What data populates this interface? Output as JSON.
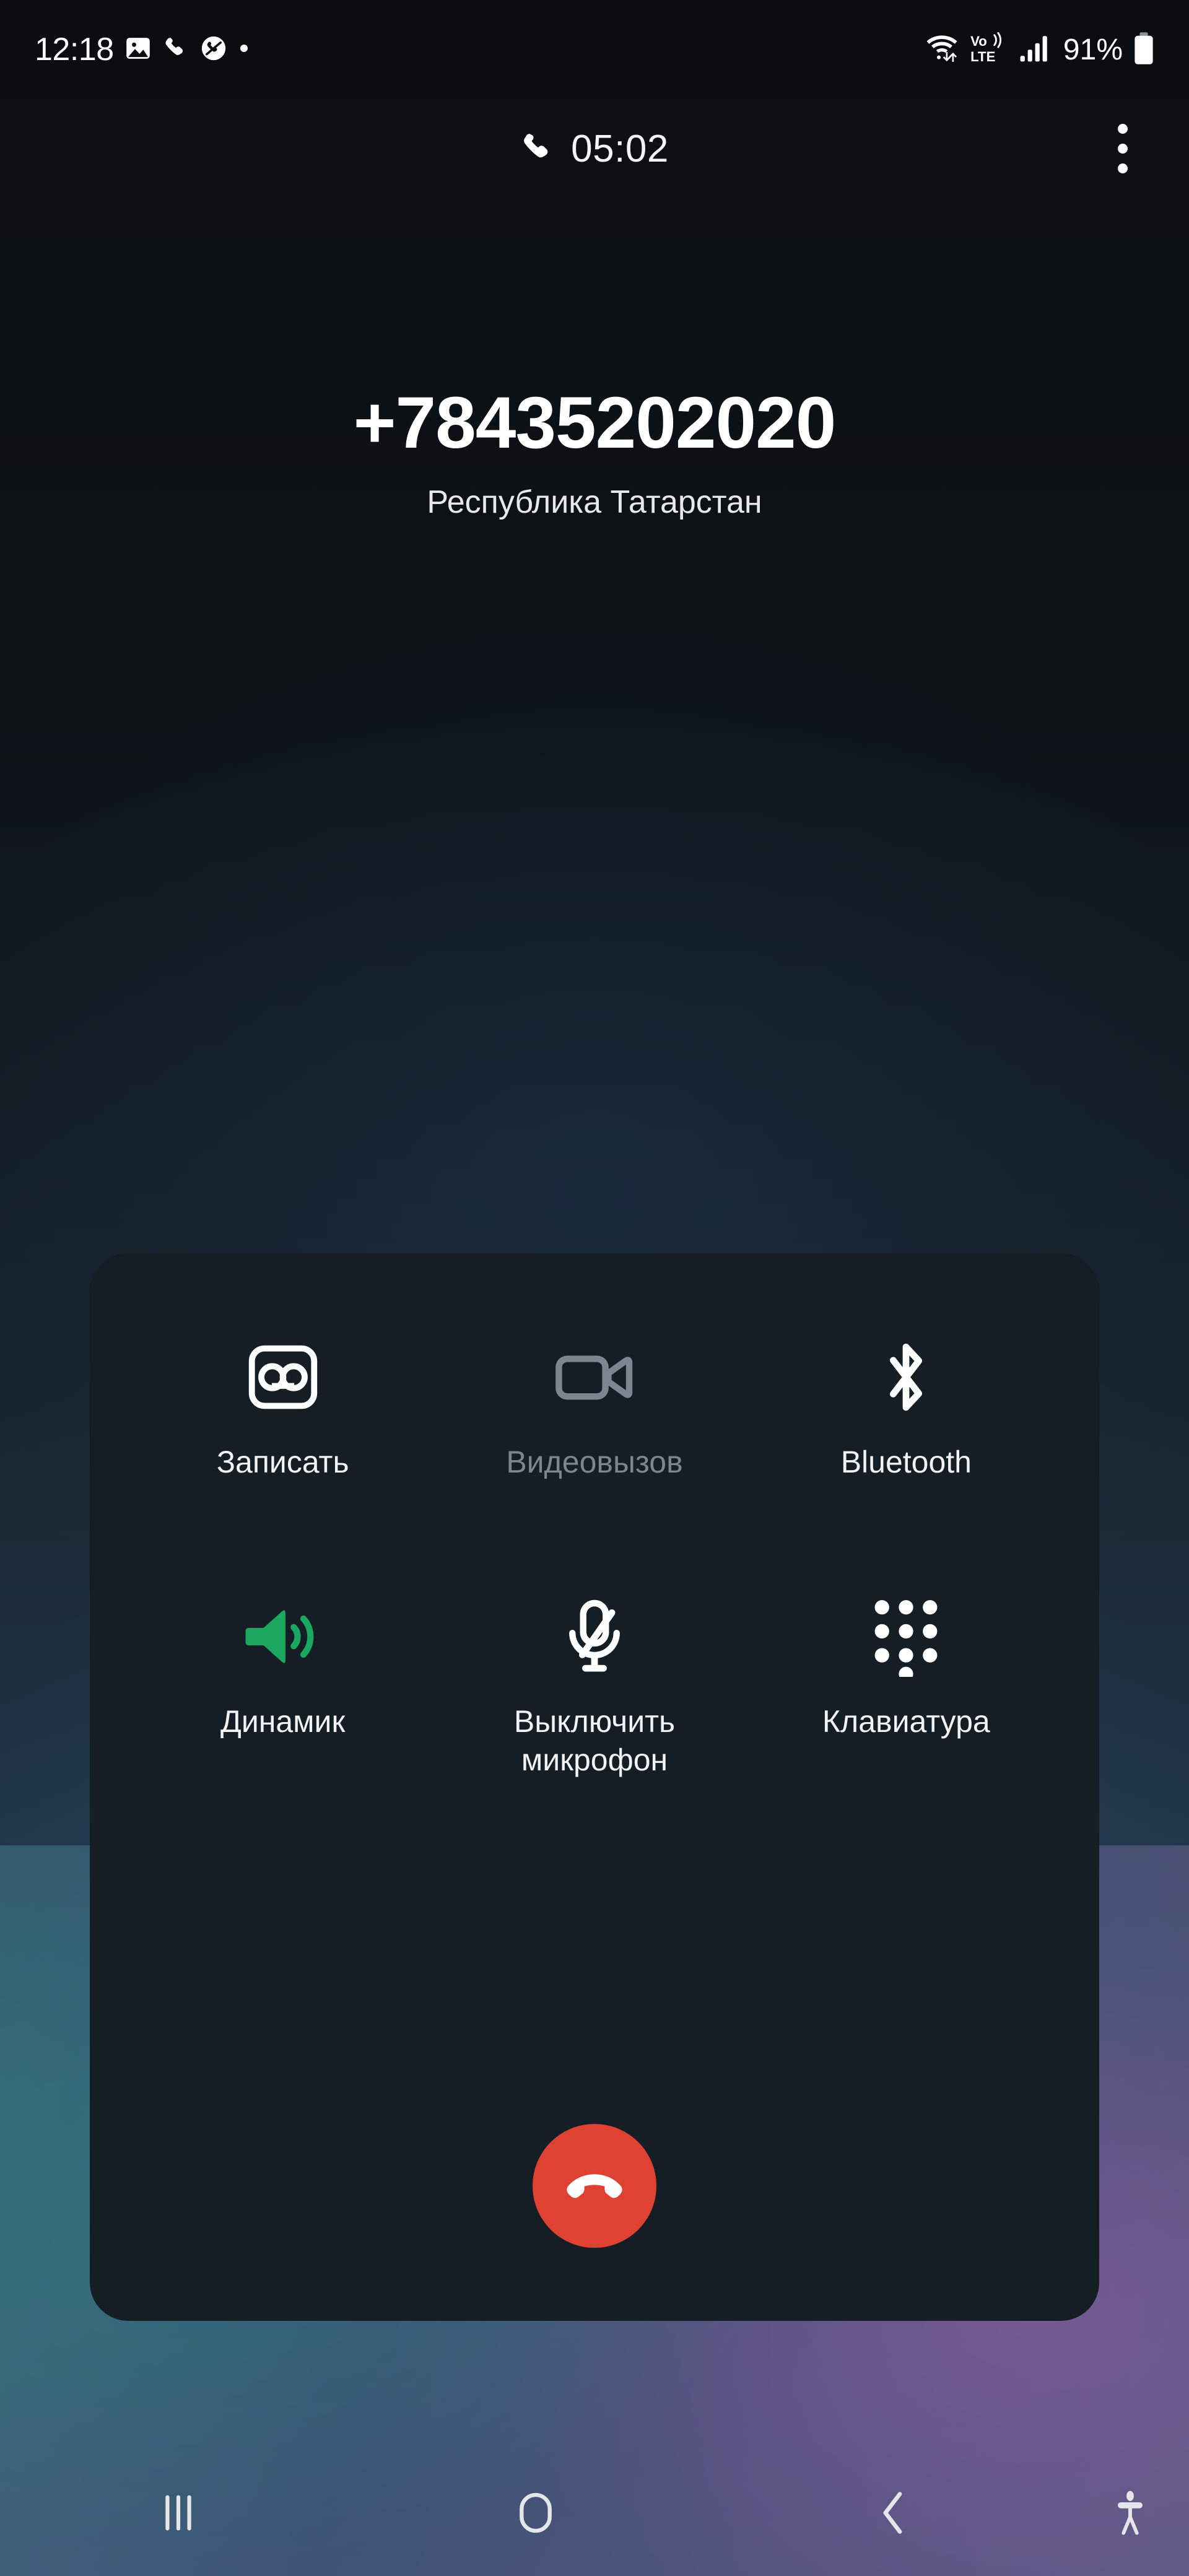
{
  "status_bar": {
    "time": "12:18",
    "battery_percent": "91%",
    "left_icons": [
      "image-icon",
      "phone-icon",
      "missed-call-icon",
      "dot-icon"
    ],
    "right_icons": [
      "wifi-icon",
      "volte-icon",
      "signal-icon",
      "battery-icon"
    ],
    "volte_label_top": "Vo",
    "volte_label_bottom": "LTE"
  },
  "call_header": {
    "timer": "05:02",
    "timer_icon": "phone-icon",
    "menu_icon": "more-vertical-icon"
  },
  "caller": {
    "number": "+78435202020",
    "location": "Республика Татарстан"
  },
  "controls": [
    {
      "id": "record",
      "label": "Записать",
      "icon": "voicemail-icon",
      "state": "enabled"
    },
    {
      "id": "video",
      "label": "Видеовызов",
      "icon": "video-camera-icon",
      "state": "disabled"
    },
    {
      "id": "bluetooth",
      "label": "Bluetooth",
      "icon": "bluetooth-icon",
      "state": "enabled"
    },
    {
      "id": "speaker",
      "label": "Динамик",
      "icon": "speaker-icon",
      "state": "active"
    },
    {
      "id": "mute",
      "label": "Выключить\nмикрофон",
      "icon": "mic-off-icon",
      "state": "enabled"
    },
    {
      "id": "keypad",
      "label": "Клавиатура",
      "icon": "dialpad-icon",
      "state": "enabled"
    }
  ],
  "end_call": {
    "label": "end-call",
    "icon": "call-end-icon",
    "color": "#df4132"
  },
  "nav_bar": {
    "buttons": [
      {
        "id": "recents",
        "icon": "recents-icon"
      },
      {
        "id": "home",
        "icon": "home-icon"
      },
      {
        "id": "back",
        "icon": "back-chevron-icon"
      },
      {
        "id": "accessibility",
        "icon": "accessibility-icon"
      }
    ]
  },
  "colors": {
    "accent_green": "#1aa860",
    "end_call_red": "#df4132",
    "card_bg": "#151d25",
    "disabled_grey": "#7c8590",
    "text_primary": "#f0f2f4"
  }
}
